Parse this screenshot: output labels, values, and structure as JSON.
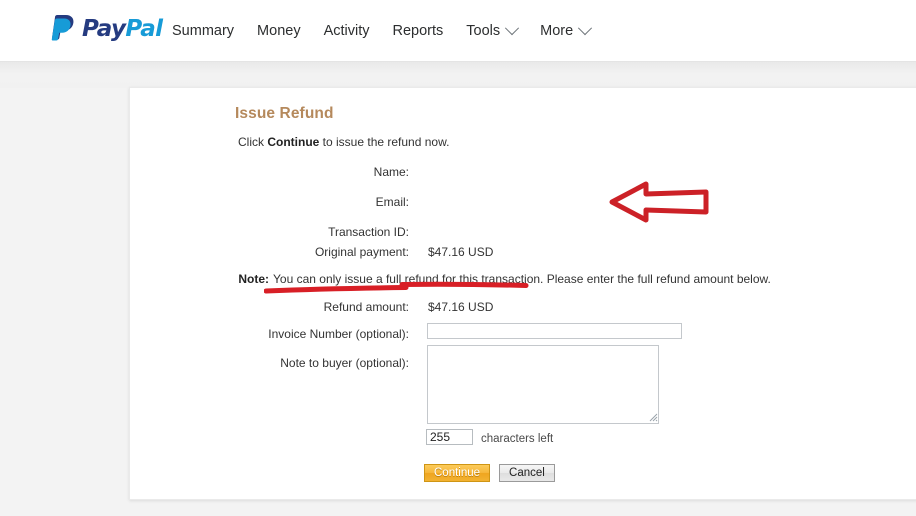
{
  "header": {
    "brand": {
      "icon": "paypal-logo-icon",
      "pay": "Pay",
      "pal": "Pal"
    },
    "nav": [
      {
        "label": "Summary",
        "has_chevron": false
      },
      {
        "label": "Money",
        "has_chevron": false
      },
      {
        "label": "Activity",
        "has_chevron": false
      },
      {
        "label": "Reports",
        "has_chevron": false
      },
      {
        "label": "Tools",
        "has_chevron": true
      },
      {
        "label": "More",
        "has_chevron": true
      }
    ]
  },
  "card": {
    "title": "Issue Refund",
    "intro_prefix": "Click ",
    "intro_bold": "Continue",
    "intro_suffix": " to issue the refund now.",
    "fields": {
      "name_label": "Name:",
      "name_value": "",
      "email_label": "Email:",
      "email_value": "",
      "transaction_label": "Transaction ID:",
      "transaction_value": "",
      "original_payment_label": "Original payment:",
      "original_payment_value": "$47.16 USD",
      "refund_amount_label": "Refund amount:",
      "refund_amount_value": "$47.16 USD",
      "invoice_label": "Invoice Number (optional):",
      "invoice_value": "",
      "invoice_placeholder": "",
      "note_to_buyer_label": "Note to buyer (optional):",
      "note_to_buyer_value": "",
      "note_to_buyer_placeholder": "",
      "chars_value": "255",
      "chars_label": "characters left"
    },
    "note": {
      "label": "Note:",
      "text": "You can only issue a full refund for this transaction. Please enter the full refund amount below."
    },
    "buttons": {
      "continue": "Continue",
      "cancel": "Cancel"
    }
  },
  "annotations": {
    "underline_color": "#d81f26",
    "arrow_color": "#cc2127",
    "arrow_name": "red-left-arrow-annotation"
  },
  "colors": {
    "brand_dark": "#253b80",
    "brand_light": "#179bd7",
    "title": "#b5895c",
    "continue_button": "#f2b232",
    "page_background": "#f3f3f3"
  }
}
